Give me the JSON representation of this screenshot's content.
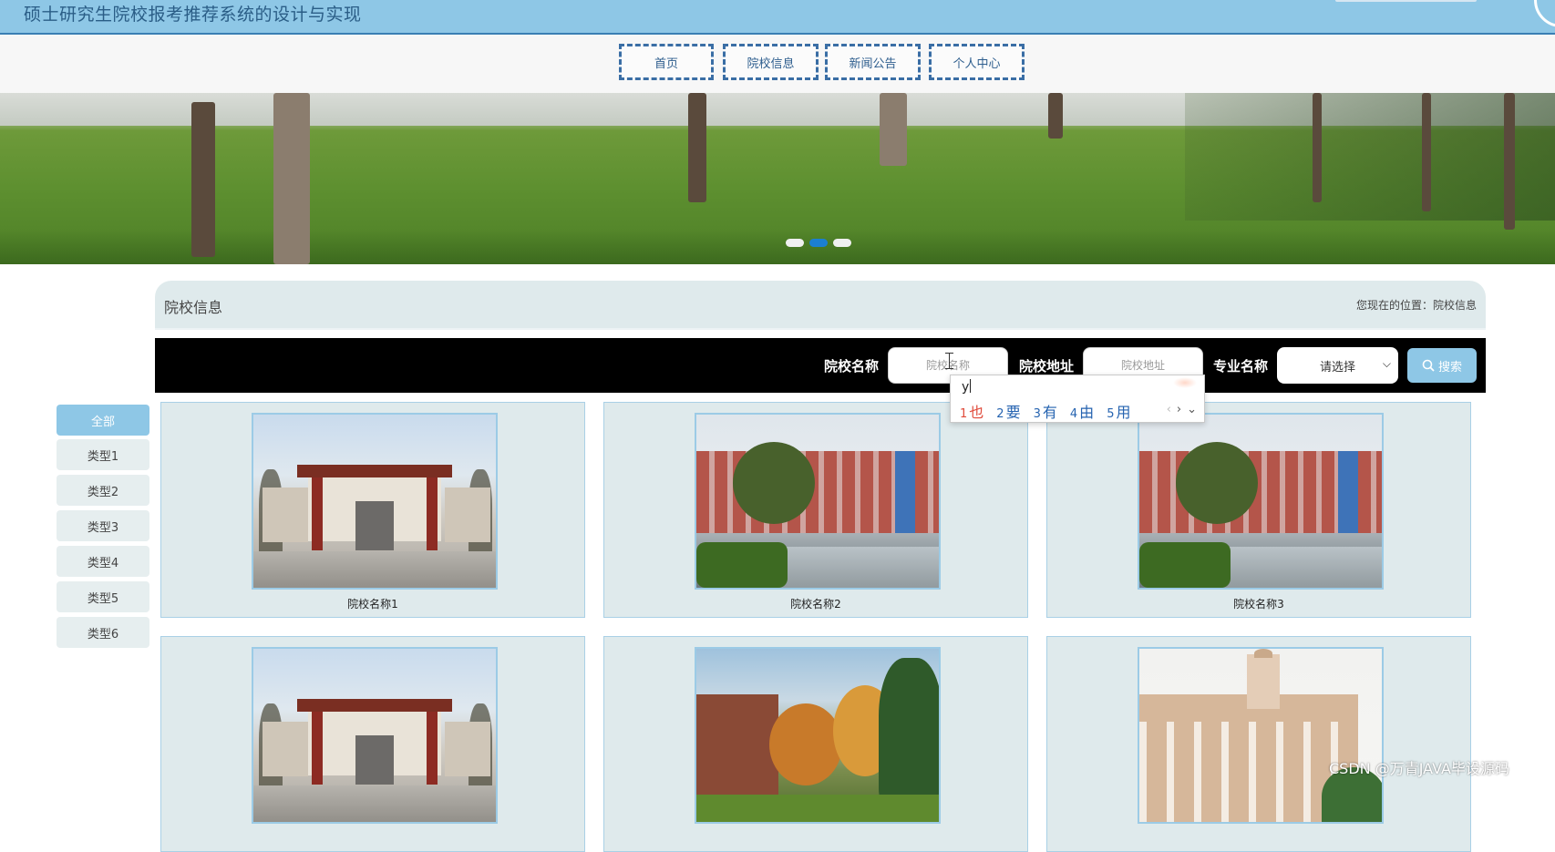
{
  "header": {
    "site_title": "硕士研究生院校报考推荐系统的设计与实现"
  },
  "nav": {
    "items": [
      "首页",
      "院校信息",
      "新闻公告",
      "个人中心"
    ]
  },
  "carousel": {
    "slides": 3,
    "active_index": 1
  },
  "section": {
    "title": "院校信息",
    "breadcrumb": "您现在的位置：院校信息"
  },
  "search": {
    "school_name_label": "院校名称",
    "school_name_placeholder": "院校名称",
    "school_address_label": "院校地址",
    "school_address_placeholder": "院校地址",
    "major_label": "专业名称",
    "major_selected": "请选择",
    "search_button": "搜索"
  },
  "ime": {
    "typed": "y",
    "candidates": [
      {
        "num": "1",
        "text": "也"
      },
      {
        "num": "2",
        "text": "要"
      },
      {
        "num": "3",
        "text": "有"
      },
      {
        "num": "4",
        "text": "由"
      },
      {
        "num": "5",
        "text": "用"
      }
    ]
  },
  "sidebar": {
    "items": [
      "全部",
      "类型1",
      "类型2",
      "类型3",
      "类型4",
      "类型5",
      "类型6"
    ]
  },
  "cards": [
    {
      "name": "院校名称1",
      "photo": "gate"
    },
    {
      "name": "院校名称2",
      "photo": "building"
    },
    {
      "name": "院校名称3",
      "photo": "building"
    },
    {
      "name": "",
      "photo": "gate"
    },
    {
      "name": "",
      "photo": "autumn-campus"
    },
    {
      "name": "",
      "photo": "colonial-building"
    }
  ],
  "watermark": "CSDN @万青JAVA毕设源码",
  "colors": {
    "accent": "#8ec7e6",
    "nav_border": "#3a6ea5",
    "active_dot": "#1b7fd1",
    "search_bar": "#000000"
  }
}
